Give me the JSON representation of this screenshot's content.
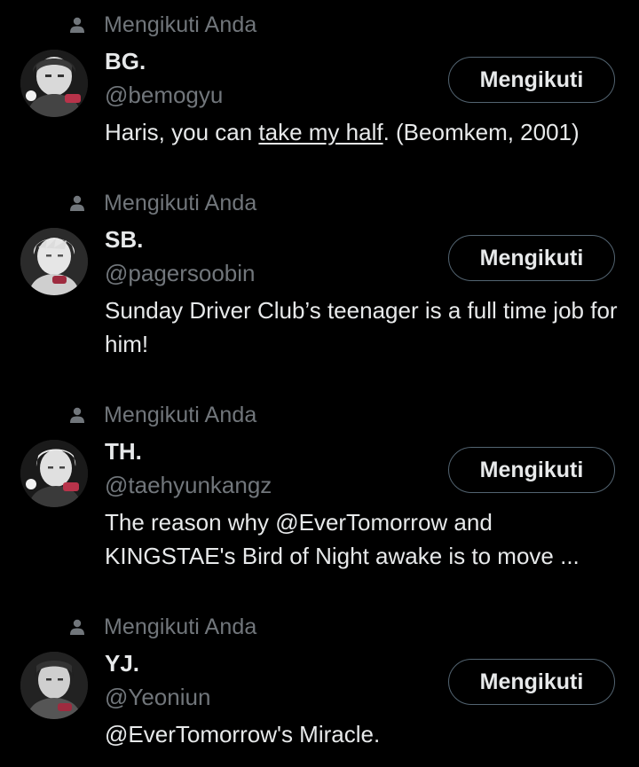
{
  "colors": {
    "background": "#000000",
    "primary_text": "#e7e9ea",
    "secondary_text": "#71767b",
    "button_border": "#536471"
  },
  "users": [
    {
      "context_icon": "person-icon",
      "context": "Mengikuti Anda",
      "name": "BG.",
      "handle": "@bemogyu",
      "button": "Mengikuti",
      "bio_parts": [
        "Haris, you can ",
        "take my half",
        ". (Beomkem, 2001)"
      ]
    },
    {
      "context_icon": "person-icon",
      "context": "Mengikuti Anda",
      "name": "SB.",
      "handle": "@pagersoobin",
      "button": "Mengikuti",
      "bio": "Sunday Driver Club’s teenager is a full time job for him!"
    },
    {
      "context_icon": "person-icon",
      "context": "Mengikuti Anda",
      "name": "TH.",
      "handle": "@taehyunkangz",
      "button": "Mengikuti",
      "bio": "The reason why @EverTomorrow and KINGSTAE's Bird of Night awake is to move ..."
    },
    {
      "context_icon": "person-icon",
      "context": "Mengikuti Anda",
      "name": "YJ.",
      "handle": "@Yeoniun",
      "button": "Mengikuti",
      "bio": "@EverTomorrow's Miracle."
    }
  ]
}
